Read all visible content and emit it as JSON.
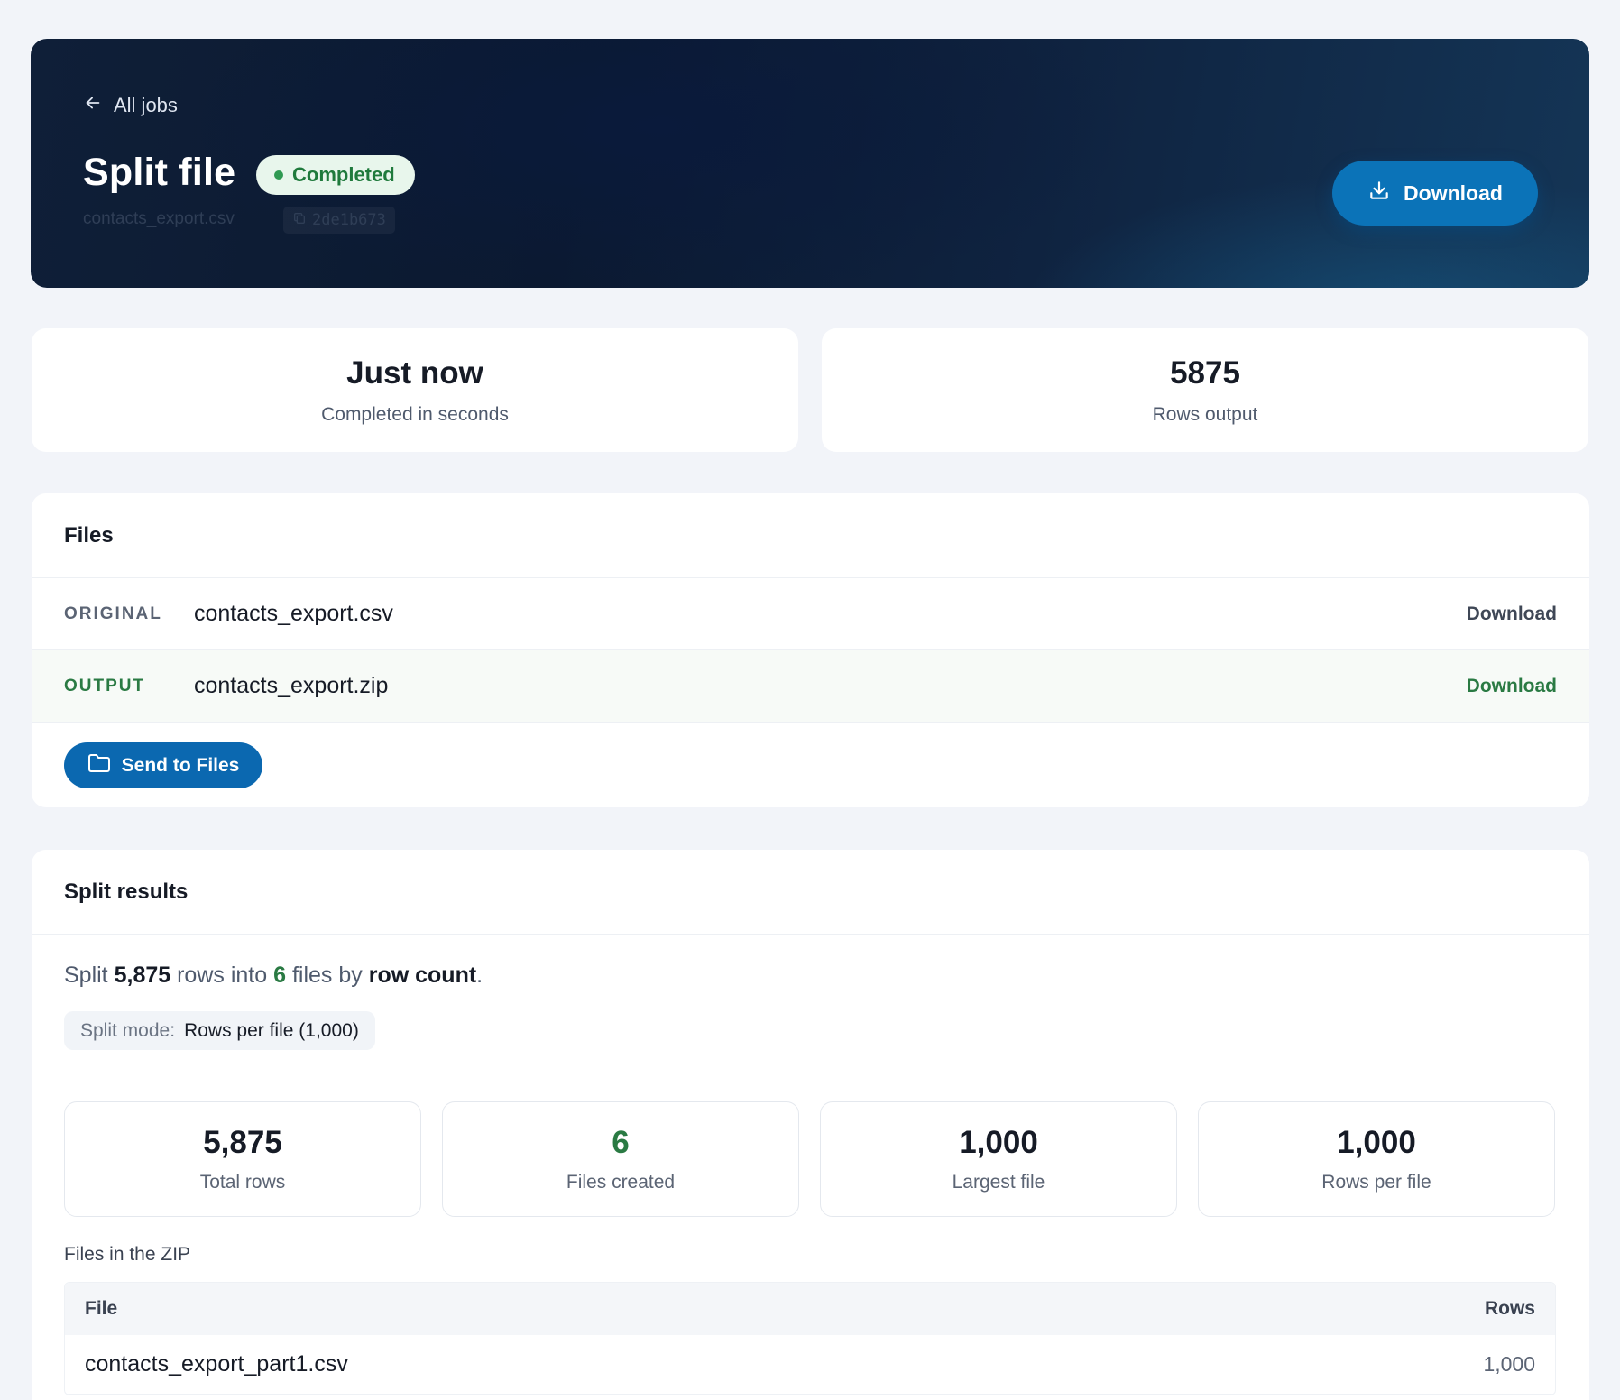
{
  "header": {
    "back_label": "All jobs",
    "title": "Split file",
    "status": "Completed",
    "source_file": "contacts_export.csv",
    "job_id": "2de1b673",
    "download_label": "Download",
    "status_color": "#2f9a52",
    "accent_color": "#0b73b8"
  },
  "stats": {
    "time": {
      "value": "Just now",
      "label": "Completed in seconds"
    },
    "rows": {
      "value": "5875",
      "label": "Rows output"
    }
  },
  "files": {
    "title": "Files",
    "original": {
      "tag": "ORIGINAL",
      "name": "contacts_export.csv",
      "action": "Download"
    },
    "output": {
      "tag": "OUTPUT",
      "name": "contacts_export.zip",
      "action": "Download"
    },
    "send_label": "Send to Files"
  },
  "results": {
    "title": "Split results",
    "summary": {
      "prefix": "Split",
      "rows": "5,875",
      "mid": "rows into",
      "files": "6",
      "mid2": "files by",
      "method": "row count",
      "end": "."
    },
    "mode_label": "Split mode:",
    "mode_value": "Rows per file (1,000)",
    "metrics": [
      {
        "value": "5,875",
        "label": "Total rows"
      },
      {
        "value": "6",
        "label": "Files created"
      },
      {
        "value": "1,000",
        "label": "Largest file"
      },
      {
        "value": "1,000",
        "label": "Rows per file"
      }
    ],
    "zip_title": "Files in the ZIP",
    "zip_columns": {
      "file": "File",
      "rows": "Rows"
    },
    "zip_rows": [
      {
        "file": "contacts_export_part1.csv",
        "rows": "1,000"
      }
    ]
  }
}
